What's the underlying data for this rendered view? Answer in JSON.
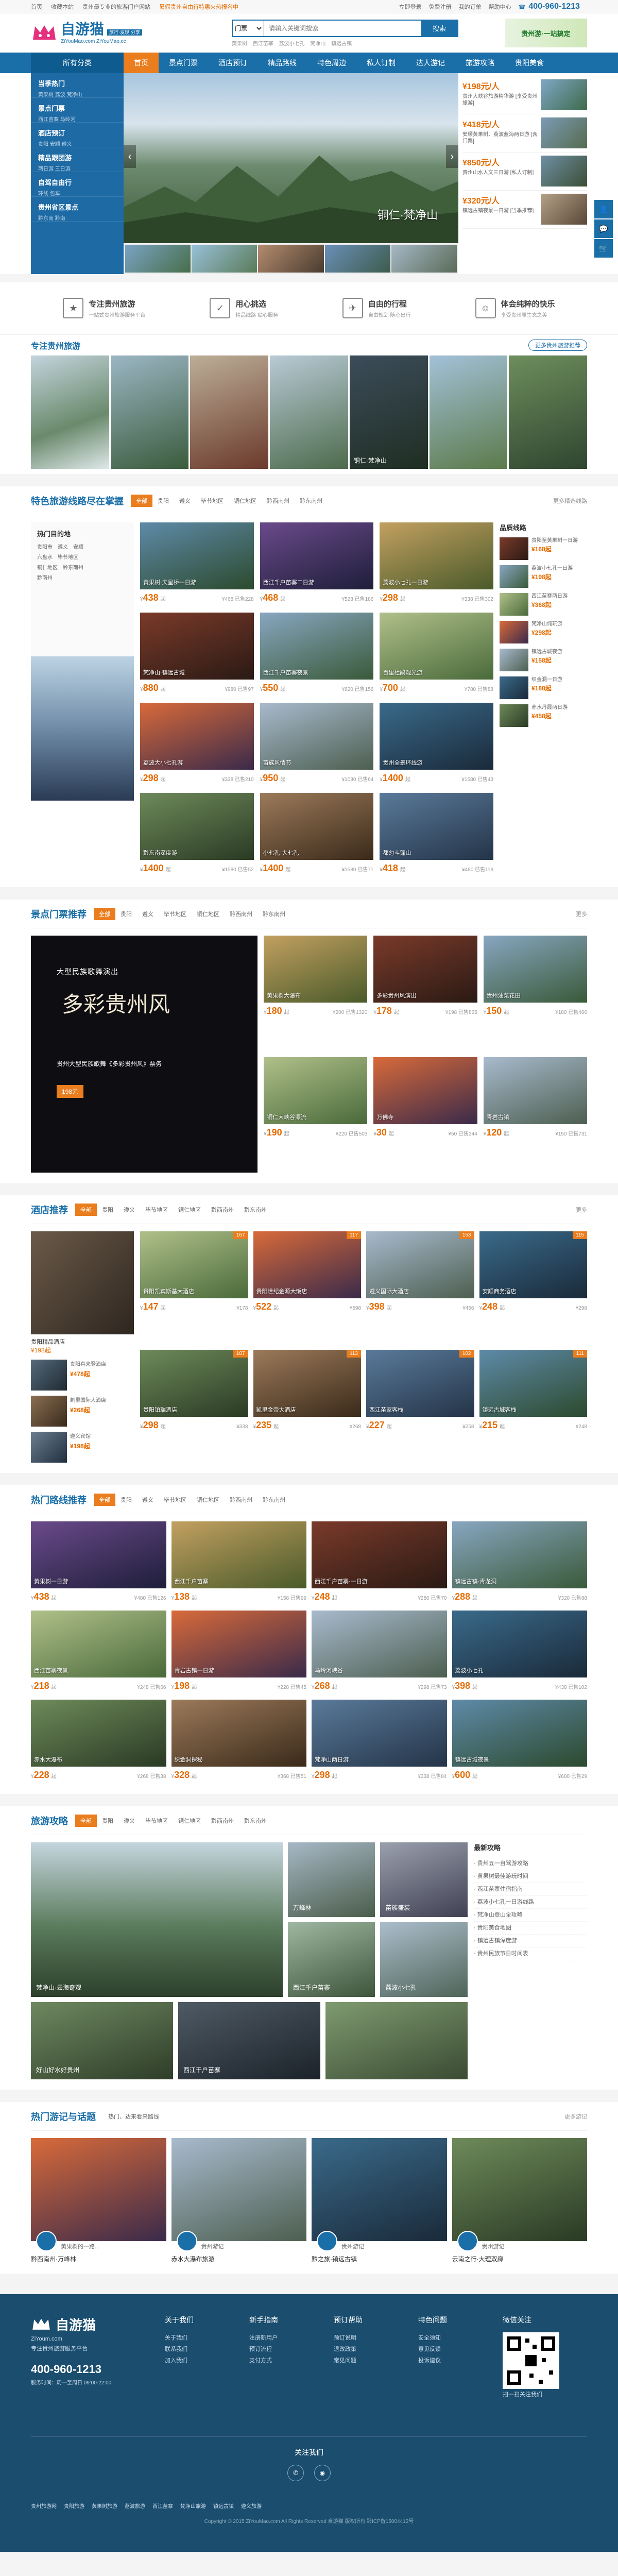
{
  "topbar": {
    "left": [
      "首页",
      "收藏本站",
      "贵州最专业的旅游门户网站"
    ],
    "notice": "暑假贵州自由行特惠火热报名中",
    "right": [
      "立即登录",
      "免费注册",
      "我的订单",
      "帮助中心"
    ],
    "tel": "400-960-1213"
  },
  "header": {
    "logo": "自游猫",
    "logo_tag": "旅行·发现·分享",
    "domain": "ZiYouMao.com  ZiYouMao.cc",
    "search_cat": "门票",
    "search_placeholder": "请输入关键词搜索",
    "search_btn": "搜索",
    "hot": [
      "黄果树",
      "西江苗寨",
      "荔波小七孔",
      "梵净山",
      "镇远古镇"
    ],
    "ad": "贵州游·一站搞定"
  },
  "nav": {
    "all": "所有分类",
    "items": [
      "首页",
      "景点门票",
      "酒店预订",
      "精品路线",
      "特色周边",
      "私人订制",
      "达人游记",
      "旅游攻略",
      "贵阳美食"
    ],
    "active": 0
  },
  "categories": [
    {
      "t": "当季热门",
      "s": "黄果树 荔波 梵净山"
    },
    {
      "t": "景点门票",
      "s": "西江苗寨 马岭河"
    },
    {
      "t": "酒店预订",
      "s": "贵阳 安顺 遵义"
    },
    {
      "t": "精品跟团游",
      "s": "两日游 三日游"
    },
    {
      "t": "自驾自由行",
      "s": "环线 包车"
    },
    {
      "t": "贵州省区景点",
      "s": "黔东南 黔南"
    }
  ],
  "slide": {
    "caption": "铜仁·梵净山"
  },
  "hotlist": [
    {
      "price": "¥198元/人",
      "name": "贵州大峡谷旅游精华游 [享受贵州旅游]"
    },
    {
      "price": "¥418元/人",
      "name": "安顺黄果树、荔波蓝海两日游 [含门票]"
    },
    {
      "price": "¥850元/人",
      "name": "贵州山水人文三日游 [私人订制]"
    },
    {
      "price": "¥320元/人",
      "name": "镇远古镇夜景一日游 [当季推荐]"
    }
  ],
  "features": [
    {
      "t": "专注贵州旅游",
      "s": "一站式贵州旅游服务平台"
    },
    {
      "t": "用心挑选",
      "s": "精品线路 贴心服务"
    },
    {
      "t": "自由的行程",
      "s": "自由规划 随心出行"
    },
    {
      "t": "体会纯粹的快乐",
      "s": "享受贵州原生态之美"
    }
  ],
  "strip": {
    "title": "专注贵州旅游",
    "more": "更多贵州旅游推荐",
    "items": [
      "",
      "",
      "",
      "",
      "铜仁·梵净山",
      "",
      ""
    ]
  },
  "routes": {
    "title": "特色旅游线路尽在掌握",
    "tabs": [
      "全部",
      "贵阳",
      "遵义",
      "毕节地区",
      "铜仁地区",
      "黔西南州",
      "黔东南州"
    ],
    "more": "更多精选线路",
    "hot": {
      "t": "热门目的地",
      "k": [
        "贵阳市",
        "遵义",
        "安顺",
        "六盘水",
        "毕节地区",
        "铜仁地区",
        "黔东南州",
        "黔南州"
      ]
    },
    "cards": [
      {
        "title": "黄果树·天星桥一日游",
        "price": "438",
        "orig": "¥468",
        "n": "已售228"
      },
      {
        "title": "西江千户苗寨二日游",
        "price": "468",
        "orig": "¥528",
        "n": "已售186"
      },
      {
        "title": "荔波小七孔一日游",
        "price": "298",
        "orig": "¥338",
        "n": "已售302"
      },
      {
        "title": "梵净山·镇远古城",
        "price": "880",
        "orig": "¥980",
        "n": "已售97"
      },
      {
        "title": "西江千户苗寨夜景",
        "price": "550",
        "orig": "¥620",
        "n": "已售156"
      },
      {
        "title": "百里杜鹃观光游",
        "price": "700",
        "orig": "¥780",
        "n": "已售88"
      },
      {
        "title": "荔波大小七孔游",
        "price": "298",
        "orig": "¥338",
        "n": "已售210"
      },
      {
        "title": "苗族风情节",
        "price": "950",
        "orig": "¥1080",
        "n": "已售64"
      },
      {
        "title": "贵州全景环线游",
        "price": "1400",
        "orig": "¥1580",
        "n": "已售43"
      },
      {
        "title": "黔东南深度游",
        "price": "1400",
        "orig": "¥1580",
        "n": "已售52"
      },
      {
        "title": "小七孔·大七孔",
        "price": "1400",
        "orig": "¥1580",
        "n": "已售71"
      },
      {
        "title": "都匀斗篷山",
        "price": "418",
        "orig": "¥480",
        "n": "已售118"
      }
    ],
    "right_title": "品质线路",
    "right": [
      {
        "n": "贵阳至黄果树一日游",
        "p": "¥168起"
      },
      {
        "n": "荔波小七孔一日游",
        "p": "¥198起"
      },
      {
        "n": "西江苗寨两日游",
        "p": "¥368起"
      },
      {
        "n": "梵净山纯玩游",
        "p": "¥298起"
      },
      {
        "n": "镇远古城夜游",
        "p": "¥158起"
      },
      {
        "n": "织金洞一日游",
        "p": "¥188起"
      },
      {
        "n": "赤水丹霞两日游",
        "p": "¥458起"
      }
    ]
  },
  "tickets": {
    "title": "景点门票推荐",
    "tabs": [
      "全部",
      "贵阳",
      "遵义",
      "毕节地区",
      "铜仁地区",
      "黔西南州",
      "黔东南州"
    ],
    "more": "更多",
    "ad": {
      "t1": "大型民族歌舞演出",
      "t2": "多彩贵州风",
      "t3": "贵州大型民族歌舞《多彩贵州风》票务",
      "price": "198元"
    },
    "cards": [
      {
        "title": "黄果树大瀑布",
        "price": "180",
        "o": "¥200 已售1320"
      },
      {
        "title": "多彩贵州风演出",
        "price": "178",
        "o": "¥198 已售865"
      },
      {
        "title": "贵州油菜花田",
        "price": "150",
        "o": "¥180 已售466"
      },
      {
        "title": "铜仁大峡谷漂流",
        "price": "190",
        "o": "¥220 已售503"
      },
      {
        "title": "万佛寺",
        "price": "30",
        "o": "¥50 已售244"
      },
      {
        "title": "青岩古镇",
        "price": "120",
        "o": "¥150 已售731"
      }
    ]
  },
  "hotels": {
    "title": "酒店推荐",
    "tabs": [
      "全部",
      "贵阳",
      "遵义",
      "毕节地区",
      "铜仁地区",
      "黔西南州",
      "黔东南州"
    ],
    "more": "更多",
    "big": {
      "name": "贵阳精品酒店",
      "price": "¥198起"
    },
    "side": [
      {
        "n": "贵阳喜来登酒店",
        "p": "¥478起"
      },
      {
        "n": "凯里国际大酒店",
        "p": "¥268起"
      },
      {
        "n": "遵义宾馆",
        "p": "¥198起"
      }
    ],
    "cards": [
      {
        "title": "贵阳凯宾斯基大酒店",
        "price": "147",
        "score": "167",
        "o": "¥178"
      },
      {
        "title": "贵阳世纪金源大饭店",
        "price": "522",
        "score": "117",
        "o": "¥598"
      },
      {
        "title": "遵义国际大酒店",
        "price": "398",
        "score": "153",
        "o": "¥456"
      },
      {
        "title": "安顺商务酒店",
        "price": "248",
        "score": "115",
        "o": "¥298"
      },
      {
        "title": "贵阳铂瑞酒店",
        "price": "298",
        "score": "107",
        "o": "¥338"
      },
      {
        "title": "凯里金帝大酒店",
        "price": "235",
        "score": "113",
        "o": "¥268"
      },
      {
        "title": "西江苗家客栈",
        "price": "227",
        "score": "102",
        "o": "¥258"
      },
      {
        "title": "镇远古城客栈",
        "price": "215",
        "score": "111",
        "o": "¥248"
      }
    ]
  },
  "hotroutes": {
    "title": "热门路线推荐",
    "tabs": [
      "全部",
      "贵阳",
      "遵义",
      "毕节地区",
      "铜仁地区",
      "黔西南州",
      "黔东南州"
    ],
    "cards": [
      {
        "title": "黄果树一日游",
        "price": "438",
        "o": "¥480 已售126"
      },
      {
        "title": "西江千户苗寨",
        "price": "138",
        "o": "¥158 已售99"
      },
      {
        "title": "西江千户苗寨·一日游",
        "price": "248",
        "o": "¥280 已售70"
      },
      {
        "title": "镇远古镇·青龙洞",
        "price": "288",
        "o": "¥320 已售88"
      },
      {
        "title": "西江苗寨夜景",
        "price": "218",
        "o": "¥248 已售66"
      },
      {
        "title": "青岩古镇一日游",
        "price": "198",
        "o": "¥228 已售45"
      },
      {
        "title": "马岭河峡谷",
        "price": "268",
        "o": "¥298 已售73"
      },
      {
        "title": "荔波小七孔",
        "price": "398",
        "o": "¥438 已售102"
      },
      {
        "title": "赤水大瀑布",
        "price": "228",
        "o": "¥268 已售38"
      },
      {
        "title": "织金洞探秘",
        "price": "328",
        "o": "¥368 已售51"
      },
      {
        "title": "梵净山两日游",
        "price": "298",
        "o": "¥338 已售84"
      },
      {
        "title": "镇远古城夜景",
        "price": "600",
        "o": "¥680 已售29"
      }
    ]
  },
  "guides": {
    "title": "旅游攻略",
    "tabs": [
      "全部",
      "贵阳",
      "遵义",
      "毕节地区",
      "铜仁地区",
      "黔西南州",
      "黔东南州"
    ],
    "main": "梵净山·云海奇观",
    "items": [
      "万峰林",
      "苗族盛装",
      "西江千户苗寨",
      "荔波小七孔",
      "好山好水好贵州",
      "西江千户苗寨"
    ],
    "news_title": "最新攻略",
    "news": [
      "贵州五一自驾游攻略",
      "黄果树最佳游玩时间",
      "西江苗寨住宿指南",
      "荔波小七孔一日游线路",
      "梵净山登山全攻略",
      "贵阳美食地图",
      "镇远古镇深度游",
      "贵州民族节日时间表"
    ]
  },
  "notes": {
    "title": "热门游记与话题",
    "sub": "热门、达来看来路线",
    "more": "更多游记",
    "items": [
      {
        "t": "黔西南州·万峰林",
        "n": "黄果树的一路..."
      },
      {
        "t": "赤水大瀑布旅游",
        "n": "贵州游记"
      },
      {
        "t": "黔之旅·镇远古镇",
        "n": "贵州游记"
      },
      {
        "t": "云南之行·大理双廊",
        "n": "贵州游记"
      }
    ]
  },
  "footer": {
    "brand": "自游猫",
    "domain": "ZiYoum.com",
    "slogan": "专注贵州旅游服务平台",
    "tel": "400-960-1213",
    "time": "服务时间：周一至周日 09:00-22:00",
    "cols": [
      {
        "h": "关于我们",
        "i": [
          "关于我们",
          "联系我们",
          "加入我们"
        ]
      },
      {
        "h": "新手指南",
        "i": [
          "注册新用户",
          "预订流程",
          "支付方式"
        ]
      },
      {
        "h": "预订帮助",
        "i": [
          "预订说明",
          "退改政策",
          "常见问题"
        ]
      },
      {
        "h": "特色问题",
        "i": [
          "安全须知",
          "意见反馈",
          "投诉建议"
        ]
      },
      {
        "h": "微信关注",
        "i": [
          "扫一扫关注我们"
        ]
      }
    ],
    "follow": "关注我们",
    "links": [
      "贵州旅游网",
      "贵阳旅游",
      "黄果树旅游",
      "荔波旅游",
      "西江苗寨",
      "梵净山旅游",
      "镇远古镇",
      "遵义旅游"
    ],
    "copyright": "Copyright © 2015 ZiYouMao.com All Rights Reserved 自游猫 版权所有 黔ICP备15004412号"
  }
}
